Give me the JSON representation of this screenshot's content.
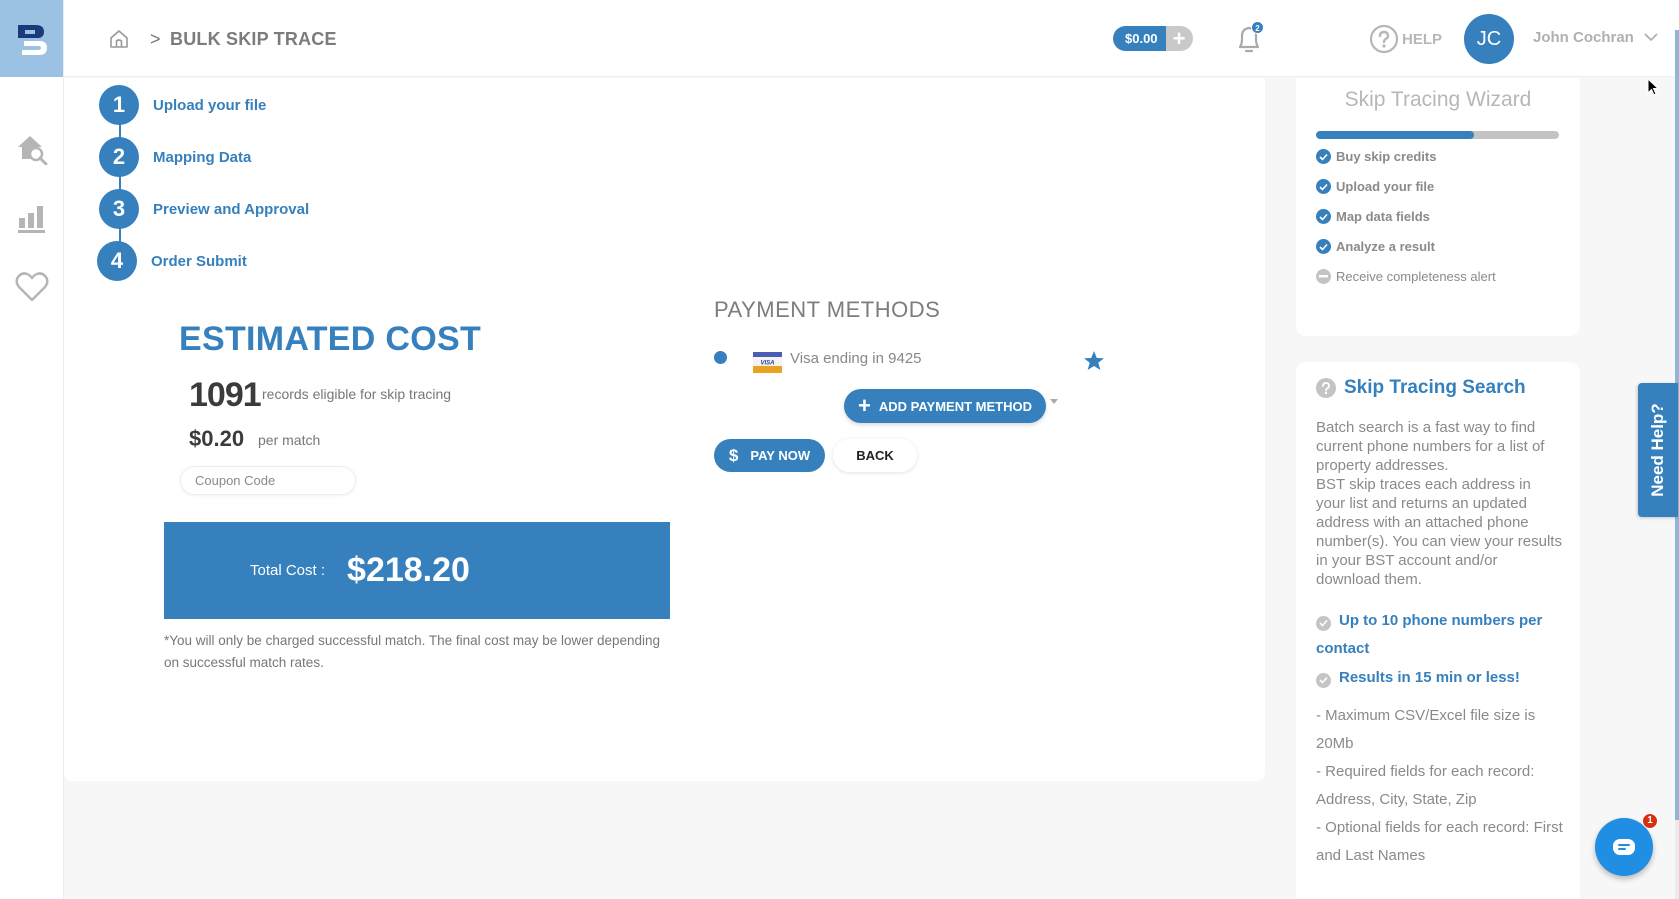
{
  "header": {
    "breadcrumb_sep": ">",
    "page_title": "BULK SKIP TRACE",
    "balance": "$0.00",
    "balance_add": "+",
    "notification_count": "2",
    "help_label": "HELP",
    "avatar_initials": "JC",
    "user_name": "John Cochran"
  },
  "sidebar": {
    "items": [
      {
        "name": "property-search",
        "icon": "house-search-icon"
      },
      {
        "name": "analytics",
        "icon": "bar-chart-icon"
      },
      {
        "name": "favorites",
        "icon": "heart-icon"
      }
    ]
  },
  "steps": [
    {
      "num": "1",
      "label": "Upload your file"
    },
    {
      "num": "2",
      "label": "Mapping Data"
    },
    {
      "num": "3",
      "label": "Preview and Approval"
    },
    {
      "num": "4",
      "label": "Order Submit"
    }
  ],
  "estimate": {
    "title": "ESTIMATED COST",
    "records": "1091",
    "records_label": "records eligible for skip tracing",
    "price": "$0.20",
    "price_label": "per match",
    "coupon_placeholder": "Coupon Code",
    "total_label": "Total Cost :",
    "total_value": "$218.20",
    "disclaimer": "*You will only be charged successful match. The final cost may be lower depending on successful match rates."
  },
  "payment": {
    "title": "PAYMENT METHODS",
    "card_brand": "VISA",
    "card_label": "Visa ending in 9425",
    "add_label": "ADD PAYMENT METHOD",
    "pay_now_label": "PAY NOW",
    "back_label": "BACK"
  },
  "wizard": {
    "title": "Skip Tracing Wizard",
    "progress": 0.65,
    "items": [
      {
        "label": "Buy skip credits",
        "done": true
      },
      {
        "label": "Upload your file",
        "done": true
      },
      {
        "label": "Map data fields",
        "done": true
      },
      {
        "label": "Analyze a result",
        "done": true
      },
      {
        "label": "Receive completeness alert",
        "done": false
      }
    ]
  },
  "search_info": {
    "title": "Skip Tracing Search",
    "description": "Batch search is a fast way to find current phone numbers for a list of property addresses.\nBST skip traces each address in your list and returns an updated address with an attached phone number(s). You can view your results in your BST account and/or download them.",
    "features": [
      "Up to 10 phone numbers per contact",
      "Results in 15 min or less!"
    ],
    "notes": [
      "- Maximum CSV/Excel file size is 20Mb",
      "- Required fields for each record: Address, City, State, Zip",
      "- Optional fields for each record: First and Last Names"
    ]
  },
  "need_help_label": "Need Help?",
  "chat_badge": "1",
  "colors": {
    "accent": "#3580bd",
    "logo_bg": "#9cc2e3",
    "muted": "#8a8a8a",
    "chat": "#1f8ee3",
    "badge_red": "#d8300f"
  }
}
